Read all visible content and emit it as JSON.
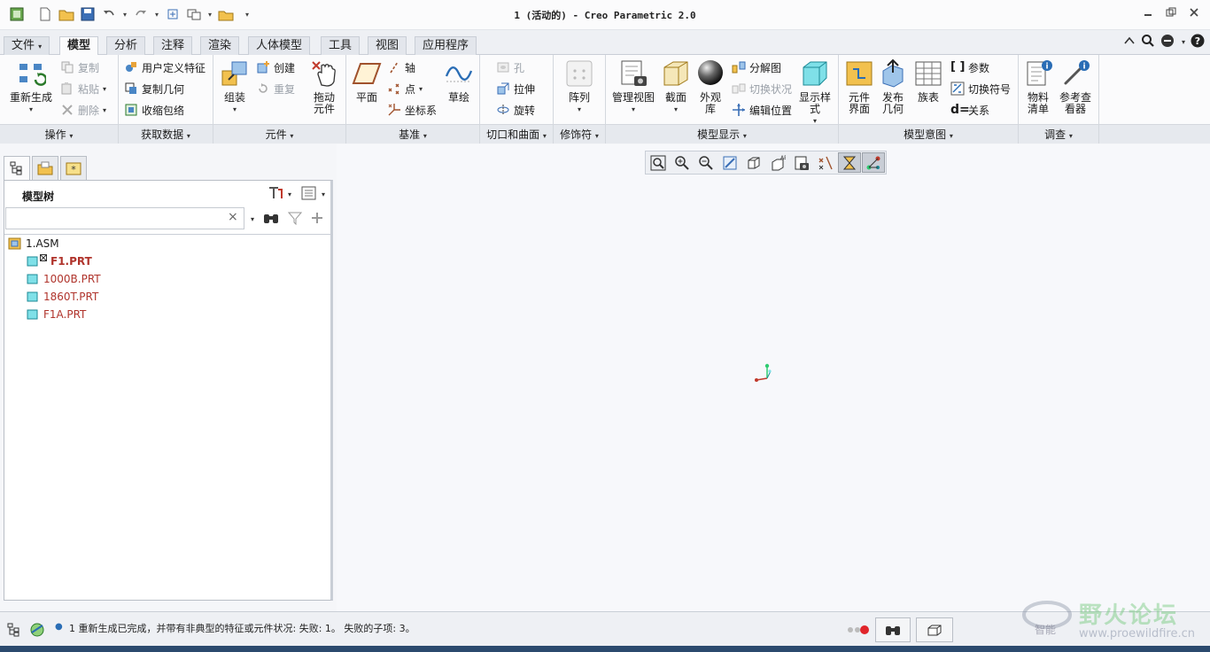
{
  "window": {
    "title": "1 (活动的) - Creo Parametric 2.0"
  },
  "tabs": [
    {
      "label": "文件",
      "has_dropdown": true
    },
    {
      "label": "模型",
      "active": true
    },
    {
      "label": "分析"
    },
    {
      "label": "注释"
    },
    {
      "label": "渲染"
    },
    {
      "label": "人体模型"
    },
    {
      "label": "工具"
    },
    {
      "label": "视图"
    },
    {
      "label": "应用程序"
    }
  ],
  "ribbon": {
    "operations": {
      "label": "操作",
      "regenerate": "重新生成",
      "copy": "复制",
      "paste": "粘贴",
      "delete": "删除"
    },
    "get_data": {
      "label": "获取数据",
      "udf": "用户定义特征",
      "copy_geom": "复制几何",
      "shrinkwrap": "收缩包络"
    },
    "component": {
      "label": "元件",
      "assemble": "组装",
      "create": "创建",
      "repeat": "重复",
      "drag": "拖动元件"
    },
    "datum": {
      "label": "基准",
      "plane": "平面",
      "axis": "轴",
      "point": "点",
      "csys": "坐标系",
      "sketch": "草绘"
    },
    "cut_surface": {
      "label": "切口和曲面",
      "hole": "孔",
      "extrude": "拉伸",
      "revolve": "旋转"
    },
    "modifiers": {
      "label": "修饰符",
      "pattern": "阵列"
    },
    "model_display": {
      "label": "模型显示",
      "manage_views": "管理视图",
      "section": "截面",
      "appearance": "外观库",
      "explode": "分解图",
      "toggle_status": "切换状况",
      "edit_position": "编辑位置",
      "display_style": "显示样式"
    },
    "model_intent": {
      "label": "模型意图",
      "comp_interface": "元件界面",
      "publish_geom": "发布几何",
      "family_table": "族表",
      "params": "参数",
      "switch_symbol": "切换符号",
      "relations": "关系"
    },
    "investigate": {
      "label": "调查",
      "bom": "物料清单",
      "ref_viewer": "参考查看器"
    }
  },
  "model_tree": {
    "header": "模型树",
    "search_value": "",
    "root": "1.ASM",
    "items": [
      {
        "name": "F1.PRT",
        "failed": true
      },
      {
        "name": "1000B.PRT"
      },
      {
        "name": "1860T.PRT"
      },
      {
        "name": "F1A.PRT"
      }
    ]
  },
  "status": {
    "message": "1 重新生成已完成，并带有非典型的特征或元件状况: 失败: 1。 失败的子项: 3。"
  },
  "watermark": {
    "text": "野火论坛",
    "url": "www.proewildfire.cn",
    "ai_label": "智能"
  },
  "colors": {
    "accent": "#2a6db5",
    "failed": "#b0342c",
    "ribbon_bg": "#fbfbfc",
    "group_label_bg": "#e6e9ee"
  }
}
